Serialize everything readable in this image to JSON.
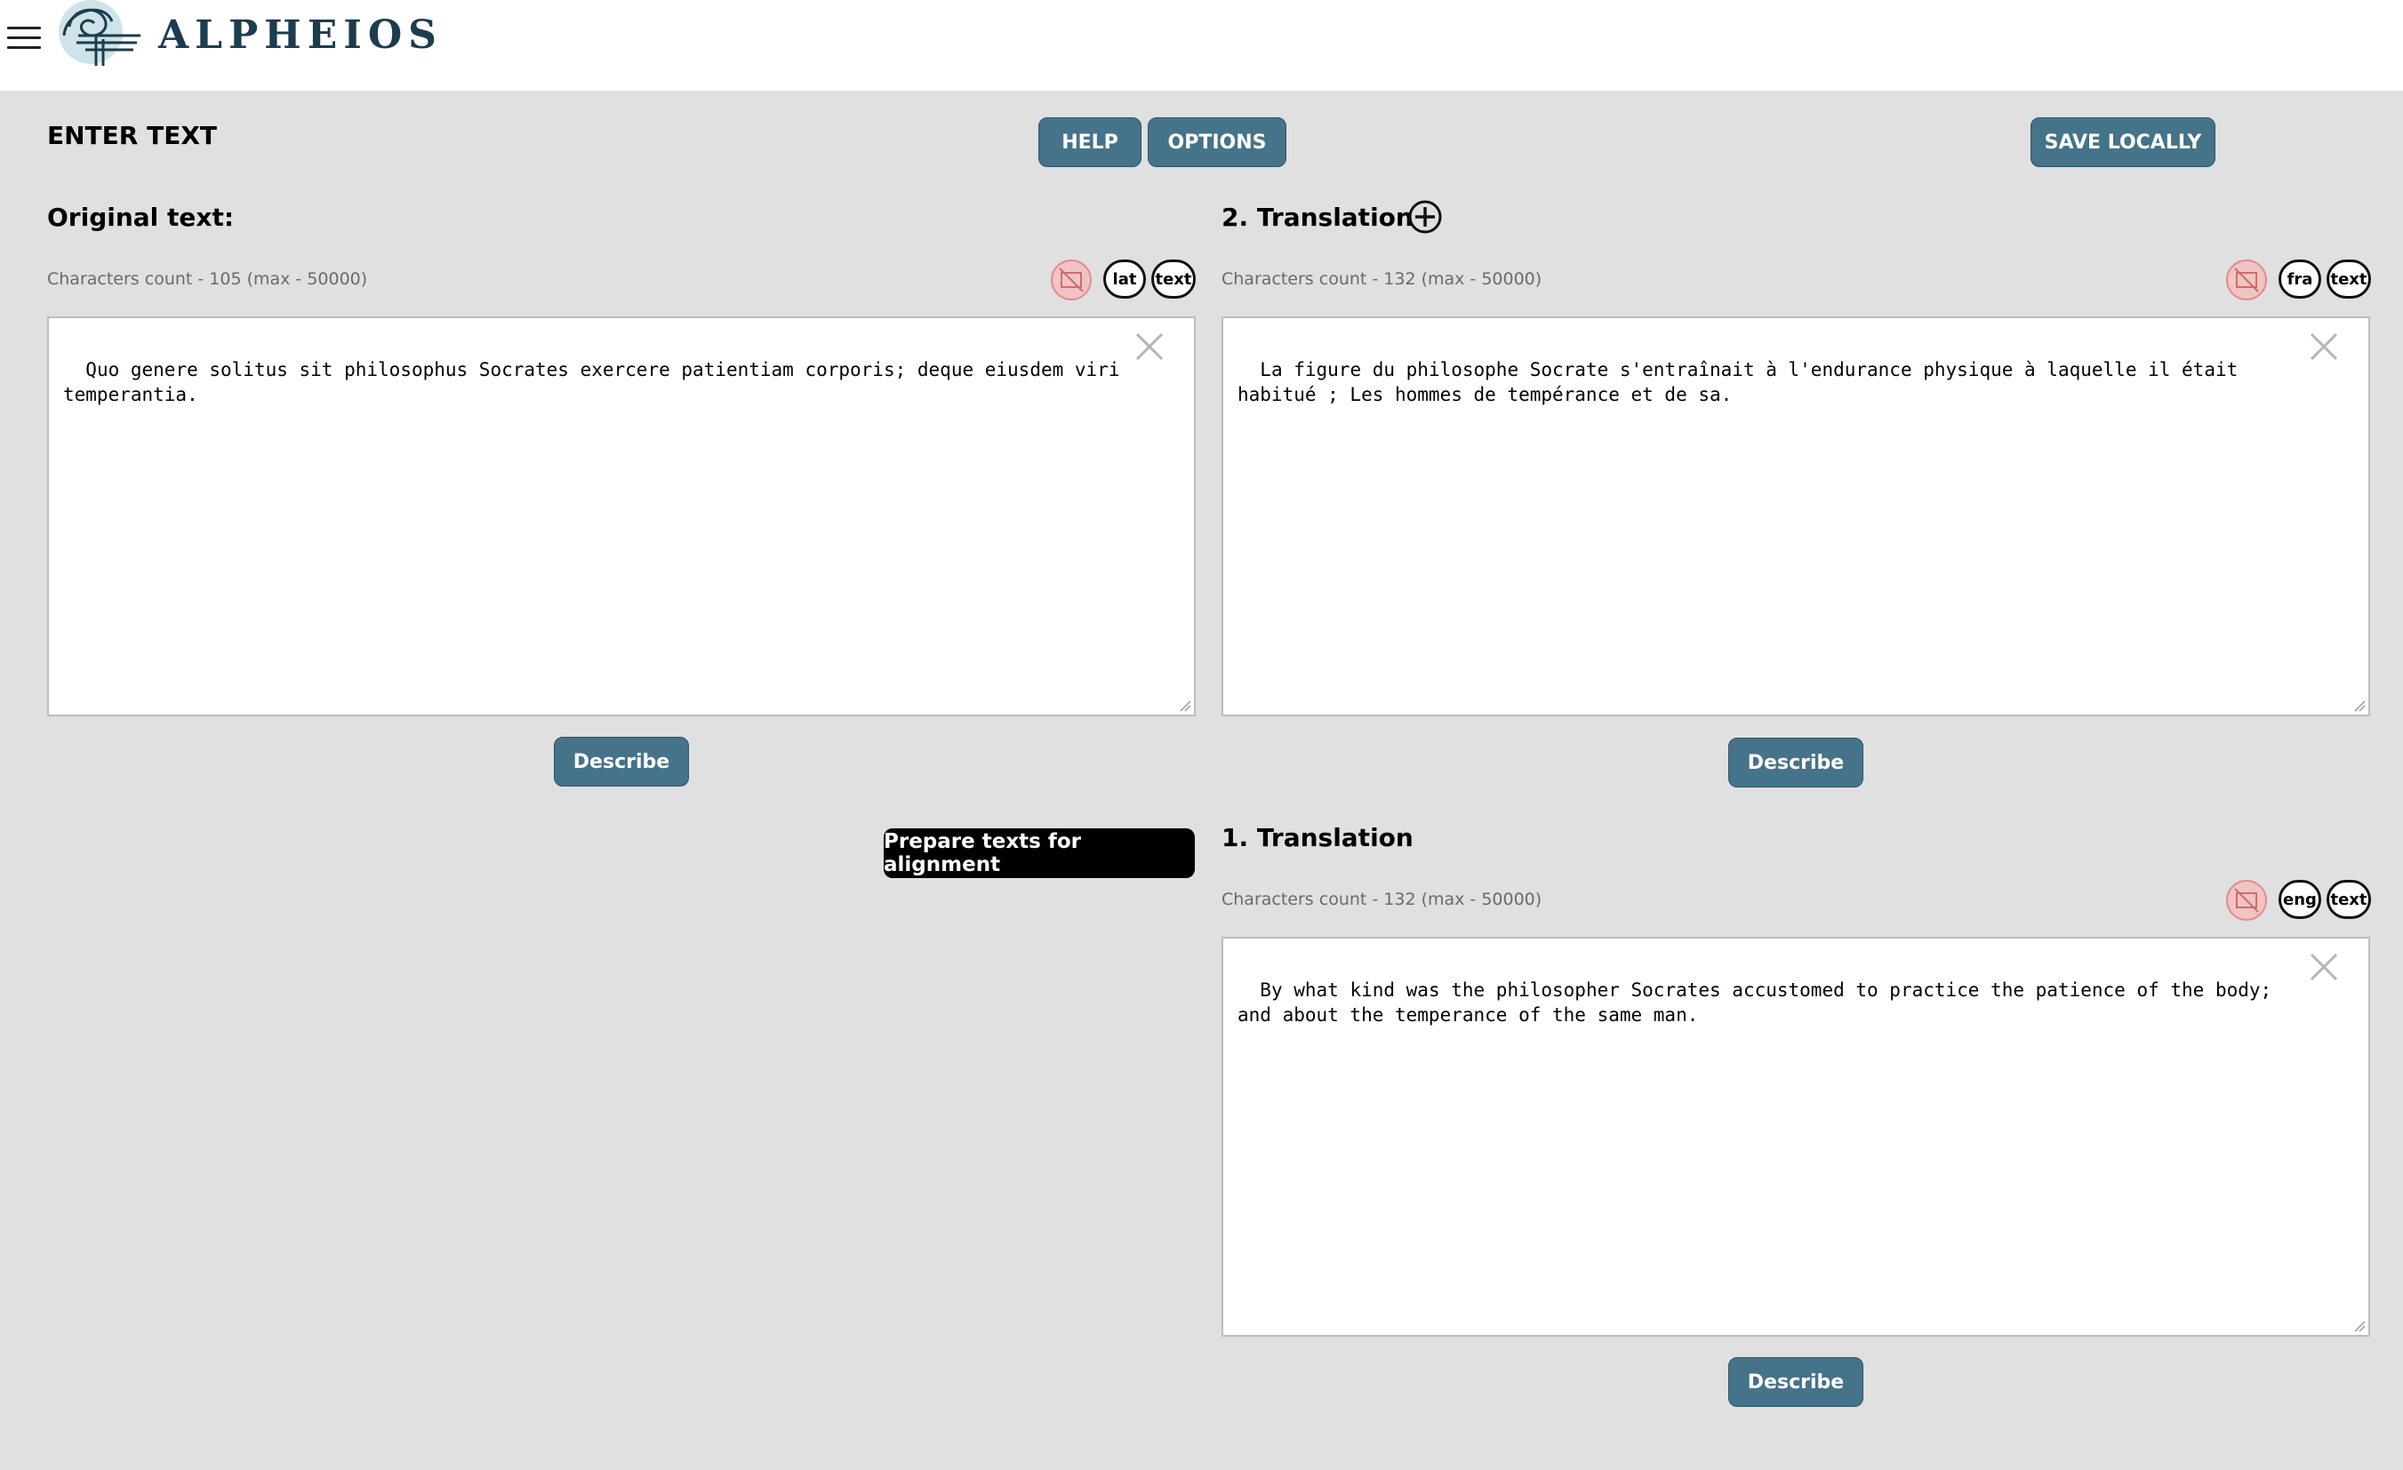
{
  "header": {
    "brand": "ALPHEIOS"
  },
  "page": {
    "title": "ENTER TEXT"
  },
  "toolbar": {
    "help": "HELP",
    "options": "OPTIONS",
    "save": "SAVE LOCALLY"
  },
  "original": {
    "title": "Original text:",
    "count": "Characters count - 105 (max - 50000)",
    "lang": "lat",
    "type": "text",
    "text": "Quo genere solitus sit philosophus Socrates exercere patientiam corporis; deque eiusdem viri temperantia.",
    "describe": "Describe"
  },
  "translation2": {
    "title": "2. Translation",
    "count": "Characters count - 132 (max - 50000)",
    "lang": "fra",
    "type": "text",
    "text": "La figure du philosophe Socrate s'entraînait à l'endurance physique à laquelle il était habitué ; Les hommes de tempérance et de sa.",
    "describe": "Describe"
  },
  "translation1": {
    "title": "1. Translation",
    "count": "Characters count - 132 (max - 50000)",
    "lang": "eng",
    "type": "text",
    "text": "By what kind was the philosopher Socrates accustomed to practice the patience of the body; and about the temperance of the same man.",
    "describe": "Describe"
  },
  "prepare": "Prepare texts for alignment",
  "colors": {
    "button": "#457389",
    "brand": "#1c3d4d",
    "background": "#e0e0e0",
    "prepare": "#000000"
  },
  "icons": [
    "menu-icon",
    "alpheios-logo",
    "plus-icon",
    "no-image-icon",
    "close-icon"
  ]
}
